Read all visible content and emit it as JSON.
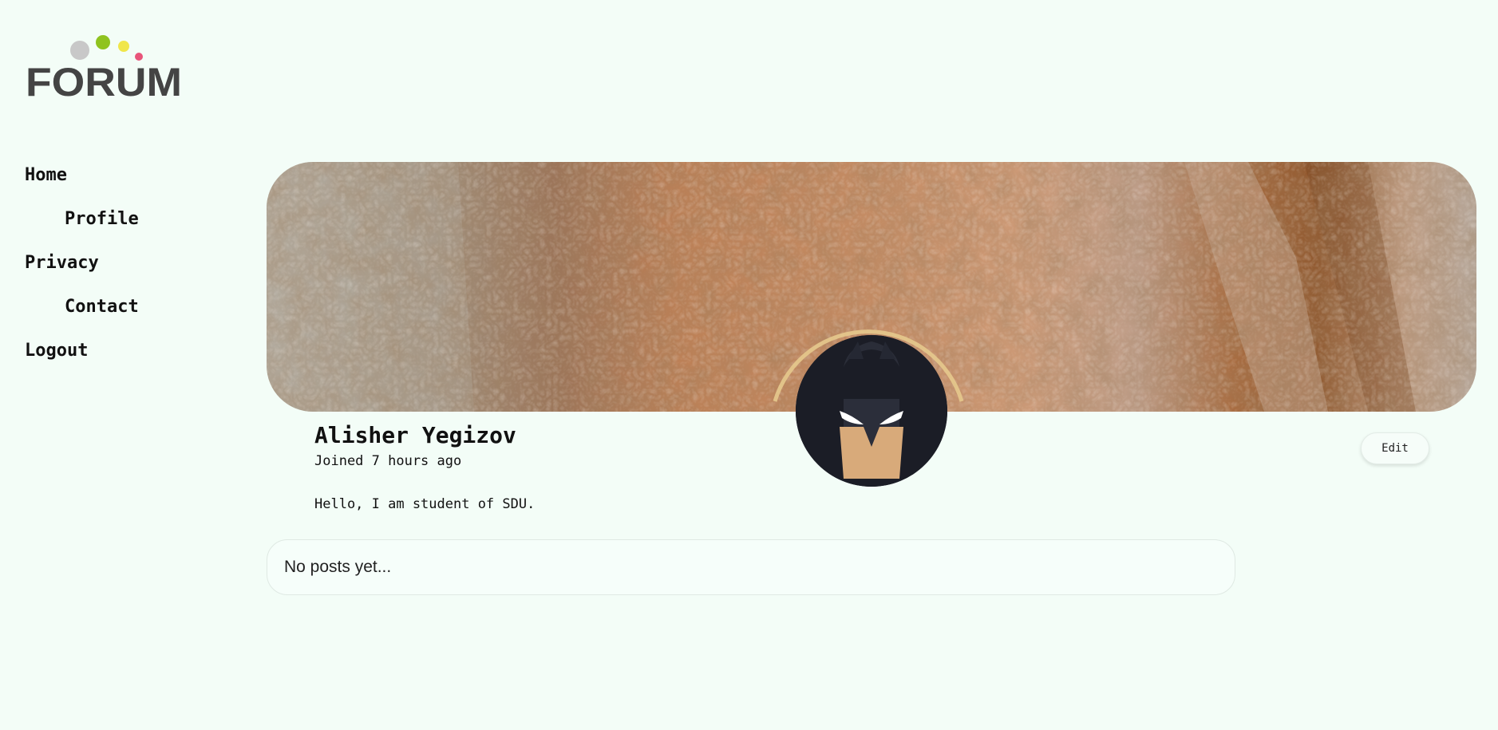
{
  "logo": {
    "text": "FORUM",
    "icon": "forum-logo",
    "colors": {
      "text": "#444444",
      "dot_gray": "#c8c8c8",
      "dot_green": "#8fc31f",
      "dot_yellow": "#f0e64a",
      "dot_pink": "#e8557a"
    }
  },
  "sidebar": {
    "items": [
      {
        "label": "Home"
      },
      {
        "label": "Profile"
      },
      {
        "label": "Privacy"
      },
      {
        "label": "Contact"
      },
      {
        "label": "Logout"
      }
    ]
  },
  "profile": {
    "name": "Alisher Yegizov",
    "joined": "Joined 7 hours ago",
    "bio": "Hello, I am student of SDU.",
    "edit_label": "Edit",
    "cover_icon": "rock-texture-image",
    "avatar_icon": "batman-avatar-icon"
  },
  "posts": {
    "empty_text": "No posts yet..."
  },
  "colors": {
    "background": "#f3fdf7",
    "text": "#111111"
  }
}
